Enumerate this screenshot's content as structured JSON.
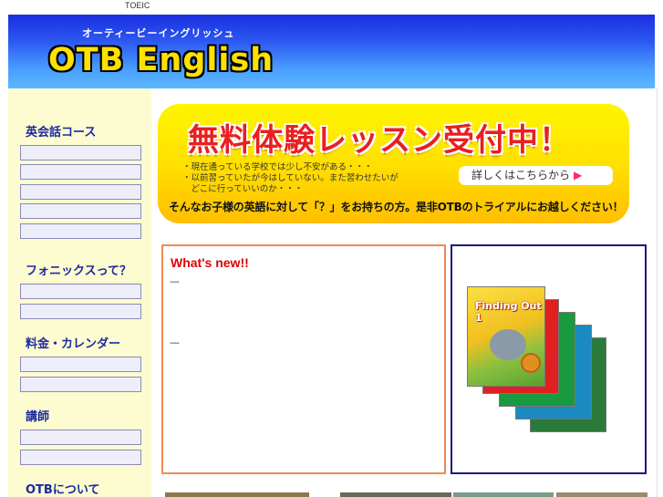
{
  "top": {
    "toeic_link": "TOEIC"
  },
  "header": {
    "kana": "オーティービーイングリッシュ",
    "brand": "OTB English",
    "brand_color": "#ffe100"
  },
  "sidebar": {
    "sections": [
      {
        "title": "英会話コース",
        "items": 5
      },
      {
        "title": "フォニックスって？",
        "items": 2
      },
      {
        "title": "料金・カレンダー",
        "items": 2
      },
      {
        "title": "講師",
        "items": 2
      },
      {
        "title": "OTBについて",
        "items": 0
      }
    ]
  },
  "banner": {
    "headline": "無料体験レッスン受付中！",
    "bullets": [
      "・現在通っている学校では少し不安がある・・・",
      "・以前習っていたが今はしていない。また習わせたいが",
      "　どこに行っていいのか・・・"
    ],
    "cta_label": "詳しくはこちらから",
    "cta_arrow": "▶",
    "tagline": "そんなお子様の英語に対して「？」をお持ちの方。是非OTBのトライアルにお越しください！"
  },
  "news": {
    "title": "What's new!!",
    "entries": [
      "—",
      "—"
    ]
  },
  "books": {
    "covers": [
      {
        "color": "#2a7a3a",
        "icon": "book-cover-icon"
      },
      {
        "color": "#1a8ac0",
        "icon": "book-cover-icon"
      },
      {
        "color": "#1a9a40",
        "icon": "book-cover-icon"
      },
      {
        "color": "#e02020",
        "icon": "book-cover-icon"
      },
      {
        "color": "#f5d020",
        "icon": "book-cover-icon"
      }
    ],
    "front_title": "Finding Out 1"
  }
}
